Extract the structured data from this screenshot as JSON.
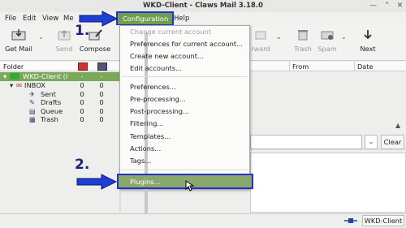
{
  "window": {
    "title": "WKD-Client - Claws Mail 3.18.0"
  },
  "menubar": {
    "file": "File",
    "edit": "Edit",
    "view": "View",
    "message_partial": "Me",
    "configuration": "Configuration",
    "help": "Help"
  },
  "toolbar": {
    "get_mail": "Get Mail",
    "send": "Send",
    "compose": "Compose",
    "forward_partial": "rward",
    "trash": "Trash",
    "spam": "Spam",
    "next": "Next"
  },
  "folder_pane": {
    "header": "Folder",
    "folders": [
      {
        "name": "WKD-Client (I",
        "unread": "-",
        "total": "-"
      },
      {
        "name": "INBOX",
        "unread": "0",
        "total": "0"
      },
      {
        "name": "Sent",
        "unread": "0",
        "total": "0"
      },
      {
        "name": "Drafts",
        "unread": "0",
        "total": "0"
      },
      {
        "name": "Queue",
        "unread": "0",
        "total": "0"
      },
      {
        "name": "Trash",
        "unread": "0",
        "total": "0"
      }
    ]
  },
  "message_list": {
    "col_from": "From",
    "col_date": "Date"
  },
  "search": {
    "clear": "Clear"
  },
  "dropdown": {
    "items": [
      {
        "label": "Change current account",
        "disabled": true
      },
      {
        "label": "Preferences for current account..."
      },
      {
        "label": "Create new account..."
      },
      {
        "label": "Edit accounts..."
      },
      {
        "label": "Preferences..."
      },
      {
        "label": "Pre-processing..."
      },
      {
        "label": "Post-processing..."
      },
      {
        "label": "Filtering..."
      },
      {
        "label": "Templates..."
      },
      {
        "label": "Actions..."
      },
      {
        "label": "Tags..."
      },
      {
        "label": "Plugins..."
      }
    ]
  },
  "annotations": {
    "step1": "1.",
    "step2": "2."
  },
  "statusbar": {
    "account": "WKD-Client"
  },
  "colors": {
    "accent_green": "#6f9e4c",
    "highlight_blue": "#2233cc",
    "arrow_blue": "#1f3fd1"
  }
}
